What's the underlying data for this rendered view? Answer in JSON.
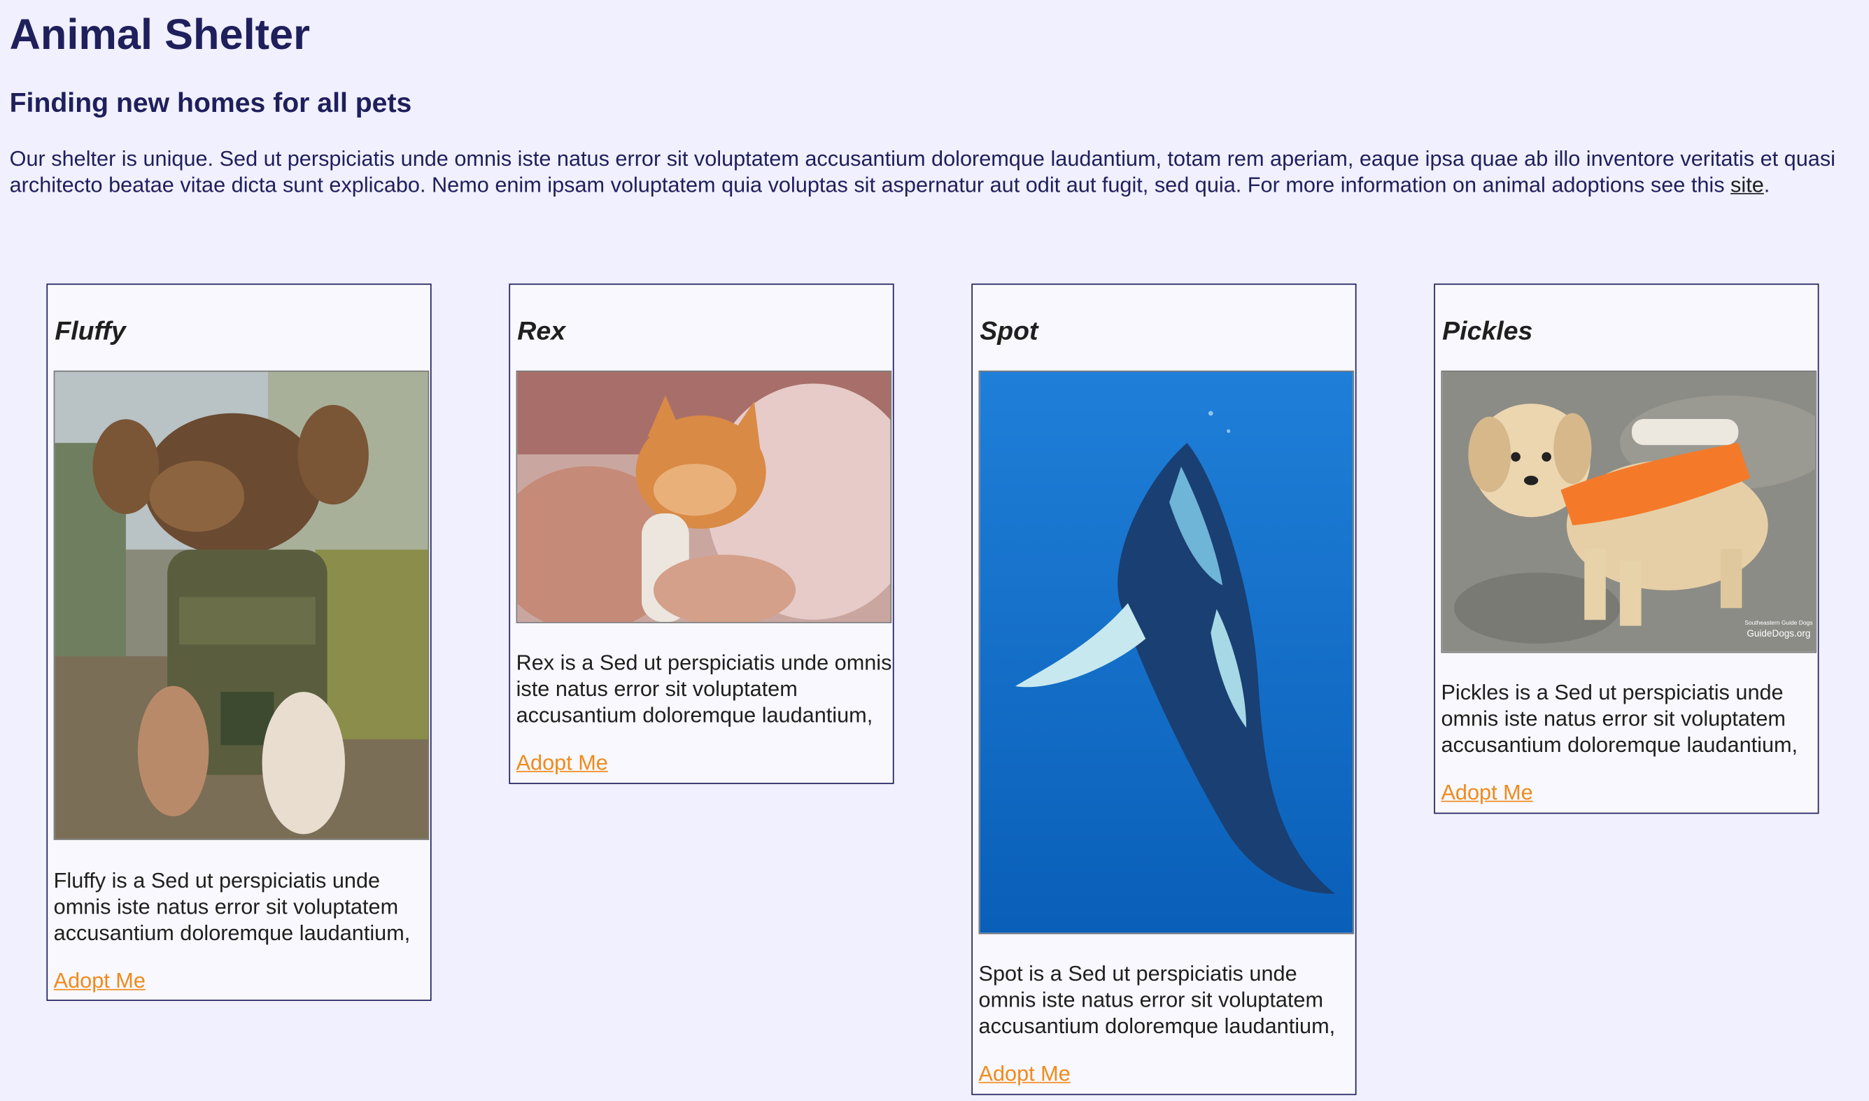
{
  "header": {
    "title": "Animal Shelter",
    "subtitle": "Finding new homes for all pets"
  },
  "intro": {
    "text": "Our shelter is unique. Sed ut perspiciatis unde omnis iste natus error sit voluptatem accusantium doloremque laudantium, totam rem aperiam, eaque ipsa quae ab illo inventore veritatis et quasi architecto beatae vitae dicta sunt explicabo. Nemo enim ipsam voluptatem quia voluptas sit aspernatur aut odit aut fugit, sed quia. For more information on animal adoptions see this ",
    "link_text": "site",
    "trailing": "."
  },
  "pets": [
    {
      "name": "Fluffy",
      "description": "Fluffy is a Sed ut perspiciatis unde omnis iste natus error sit voluptatem accusantium doloremque laudantium,",
      "adopt_label": "Adopt Me",
      "photo_icon": "chihuahua-in-vest-photo"
    },
    {
      "name": "Rex",
      "description": "Rex is a Sed ut perspiciatis unde omnis iste natus error sit voluptatem accusantium doloremque laudantium,",
      "adopt_label": "Adopt Me",
      "photo_icon": "kitten-bottle-feeding-photo"
    },
    {
      "name": "Spot",
      "description": "Spot is a Sed ut perspiciatis unde omnis iste natus error sit voluptatem accusantium doloremque laudantium,",
      "adopt_label": "Adopt Me",
      "photo_icon": "humpback-whale-photo"
    },
    {
      "name": "Pickles",
      "description": "Pickles is a Sed ut perspiciatis unde omnis iste natus error sit voluptatem accusantium doloremque laudantium,",
      "adopt_label": "Adopt Me",
      "photo_icon": "labrador-puppy-photo",
      "watermark": "Southeastern Guide Dogs GuideDogs.org"
    }
  ],
  "colors": {
    "background": "#f0f0fe",
    "heading": "#1f1f5c",
    "card_border": "#1f1f5c",
    "link": "#f08a1c"
  }
}
